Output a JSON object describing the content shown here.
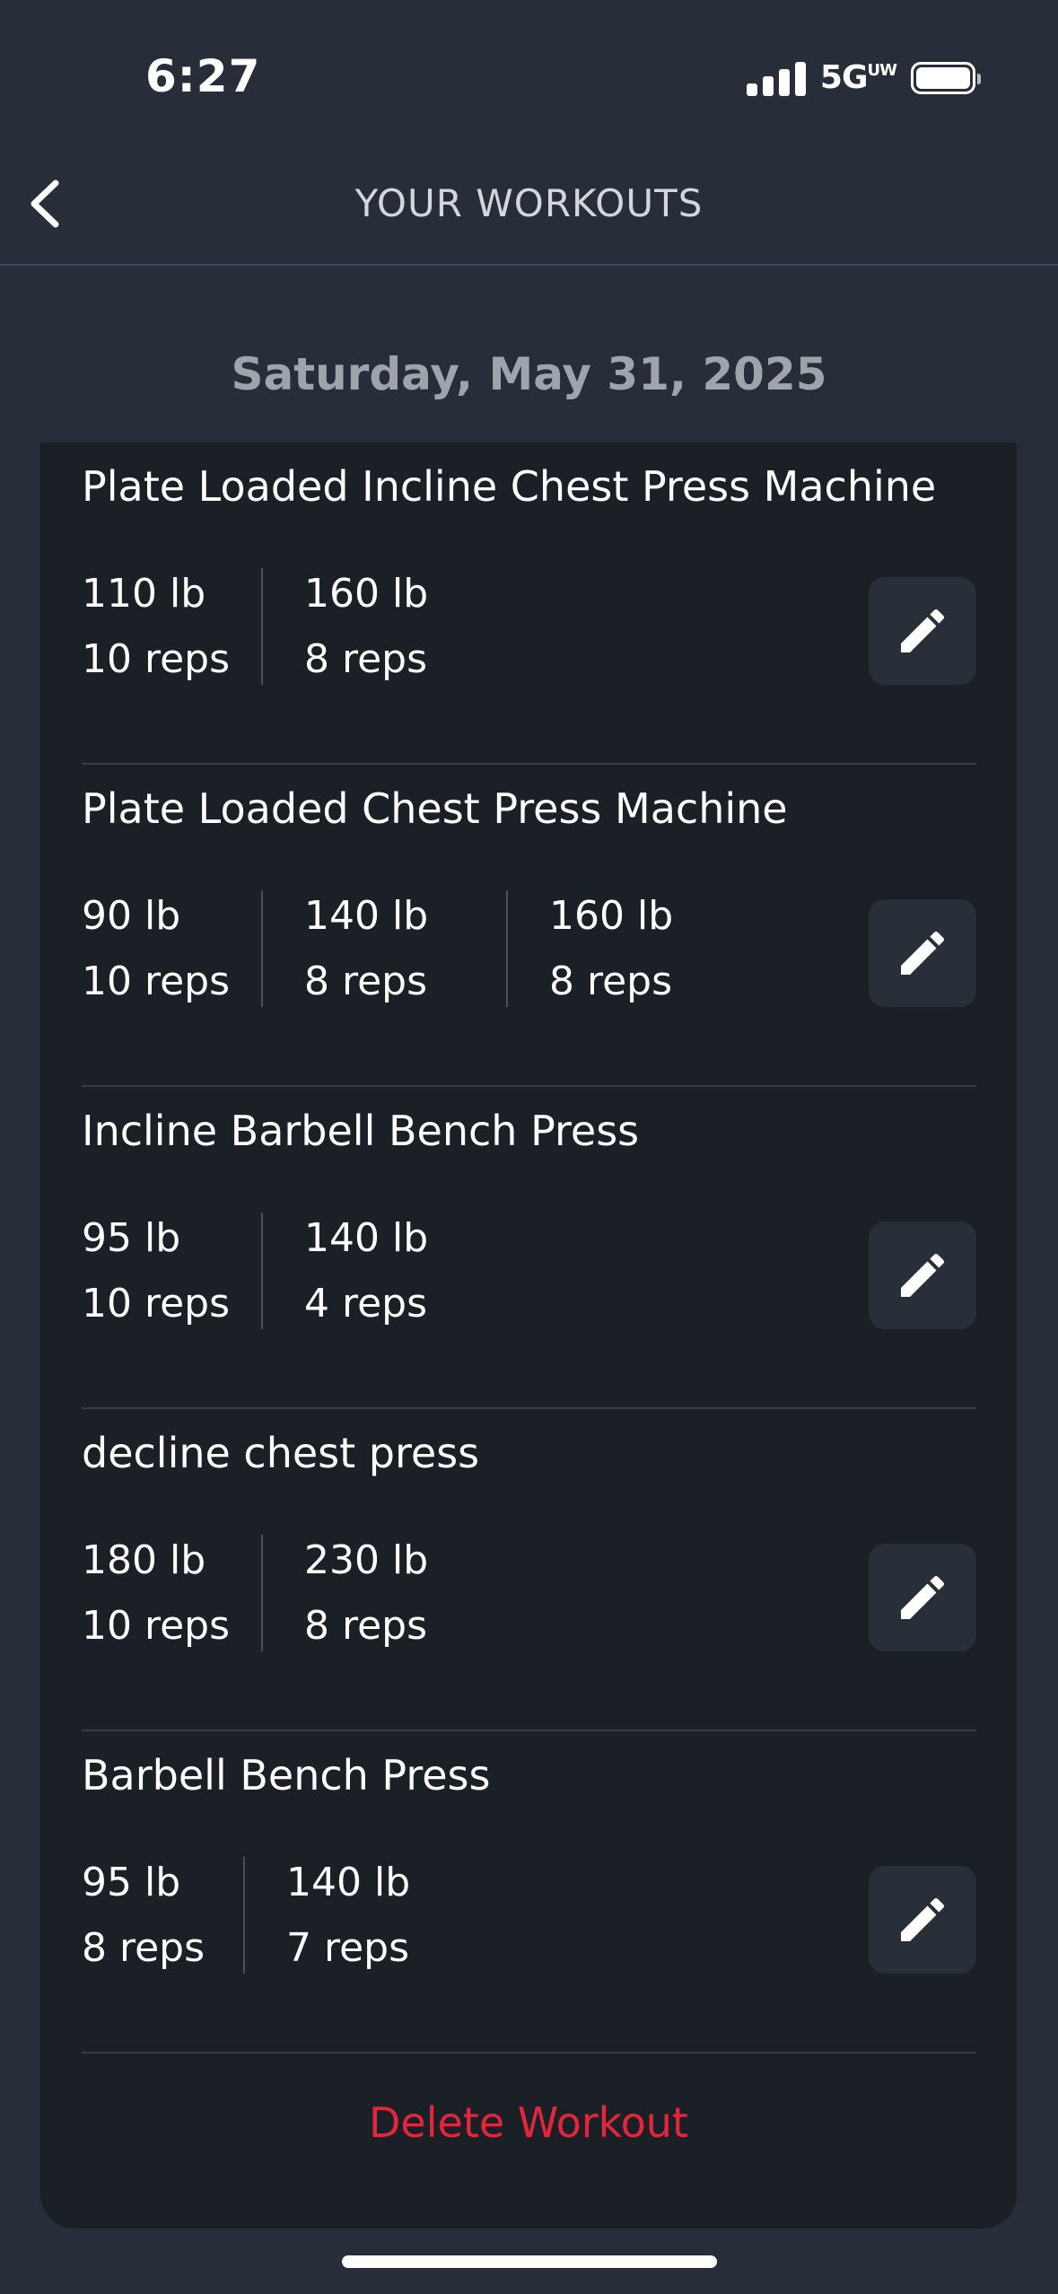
{
  "status": {
    "time": "6:27",
    "network": "5G",
    "network_sup": "UW"
  },
  "header": {
    "title": "YOUR WORKOUTS"
  },
  "date": "Saturday, May 31, 2025",
  "exercises": [
    {
      "name": "Plate Loaded Incline Chest Press Machine",
      "sets": [
        {
          "weight": "110 lb",
          "reps": "10 reps"
        },
        {
          "weight": "160 lb",
          "reps": "8 reps"
        }
      ]
    },
    {
      "name": "Plate Loaded Chest Press Machine",
      "sets": [
        {
          "weight": "90 lb",
          "reps": "10 reps"
        },
        {
          "weight": "140 lb",
          "reps": "8 reps"
        },
        {
          "weight": "160 lb",
          "reps": "8 reps"
        }
      ]
    },
    {
      "name": "Incline Barbell Bench Press",
      "sets": [
        {
          "weight": "95 lb",
          "reps": "10 reps"
        },
        {
          "weight": "140 lb",
          "reps": "4 reps"
        }
      ]
    },
    {
      "name": "decline chest press",
      "sets": [
        {
          "weight": "180 lb",
          "reps": "10 reps"
        },
        {
          "weight": "230 lb",
          "reps": "8 reps"
        }
      ]
    },
    {
      "name": "Barbell Bench Press",
      "sets": [
        {
          "weight": "95 lb",
          "reps": "8 reps"
        },
        {
          "weight": "140 lb",
          "reps": "7 reps"
        }
      ]
    }
  ],
  "actions": {
    "delete_label": "Delete Workout"
  },
  "colors": {
    "background": "#272d39",
    "card": "#1b1f26",
    "delete": "#e3263d",
    "edit_button": "#292f38"
  },
  "icons": {
    "back": "chevron-left-icon",
    "edit": "pencil-icon"
  }
}
